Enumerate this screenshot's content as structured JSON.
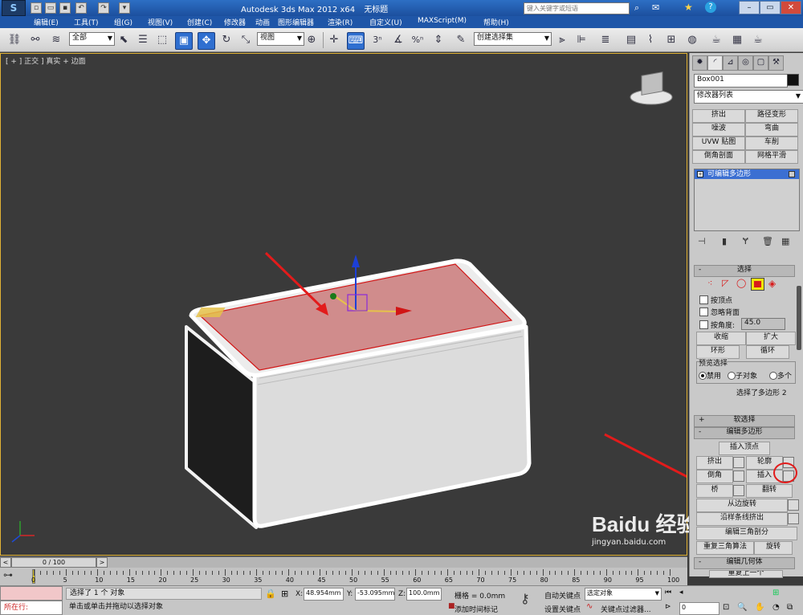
{
  "app": {
    "title_product": "Autodesk 3ds Max  2012 x64",
    "title_file": "无标题",
    "search_placeholder": "键入关键字或短语"
  },
  "menu": [
    "编辑(E)",
    "工具(T)",
    "组(G)",
    "视图(V)",
    "创建(C)",
    "修改器",
    "动画",
    "图形编辑器",
    "渲染(R)",
    "自定义(U)",
    "MAXScript(M)",
    "帮助(H)"
  ],
  "toolbar": {
    "filter_value": "全部",
    "refcoord_value": "视图",
    "named_selection": "创建选择集",
    "snap_label": "3",
    "percent_label": "%"
  },
  "viewport": {
    "label": "[ + ] 正交 ] 真实 + 边面"
  },
  "panel": {
    "object_name": "Box001",
    "modifier_list": "修改器列表",
    "modifier_buttons": [
      "挤出",
      "路径变形",
      "噪波",
      "弯曲",
      "UVW 贴图",
      "车削",
      "倒角剖面",
      "网格平滑"
    ],
    "stack_item": "可编辑多边形",
    "rollout_select": "选择",
    "by_vertex": "按顶点",
    "ignore_backface": "忽略背面",
    "by_angle": "按角度:",
    "angle_value": "45.0",
    "shrink": "收缩",
    "grow": "扩大",
    "ring": "环形",
    "loop": "循环",
    "preview_title": "预览选择",
    "preview_off": "禁用",
    "preview_sub": "子对象",
    "preview_multi": "多个",
    "selection_info": "选择了多边形 2",
    "soft_select": "软选择",
    "edit_poly": "编辑多边形",
    "insert_vertex": "插入顶点",
    "extrude": "挤出",
    "outline": "轮廓",
    "bevel": "倒角",
    "inset": "插入",
    "bridge": "桥",
    "flip": "翻转",
    "hinge": "从边旋转",
    "extrude_spline": "沿样条线挤出",
    "edit_tri": "编辑三角剖分",
    "retri": "重复三角算法",
    "turn": "旋转",
    "edit_geo": "编辑几何体",
    "repeat_last": "重复上一个"
  },
  "timeline": {
    "frame": "0 / 100",
    "ticks": [
      "0",
      "5",
      "10",
      "15",
      "20",
      "25",
      "30",
      "35",
      "40",
      "45",
      "50",
      "55",
      "60",
      "65",
      "70",
      "75",
      "80",
      "85",
      "90",
      "95",
      "100"
    ]
  },
  "status": {
    "script_listener": "所在行:",
    "selection_msg": "选择了 1 个 对象",
    "prompt_msg": "单击或单击并拖动以选择对象",
    "x_label": "X:",
    "x_value": "48.954mm",
    "y_label": "Y:",
    "y_value": "-53.095mm",
    "z_label": "Z:",
    "z_value": "100.0mm",
    "grid": "栅格 = 0.0mm",
    "add_tag": "添加时间标记",
    "autokey": "自动关键点",
    "set_key": "设置关键点",
    "selected": "选定对象",
    "key_filters": "关键点过滤器...",
    "frame_field": "0"
  },
  "watermark": "Baidu 经验",
  "watermark_url": "jingyan.baidu.com"
}
